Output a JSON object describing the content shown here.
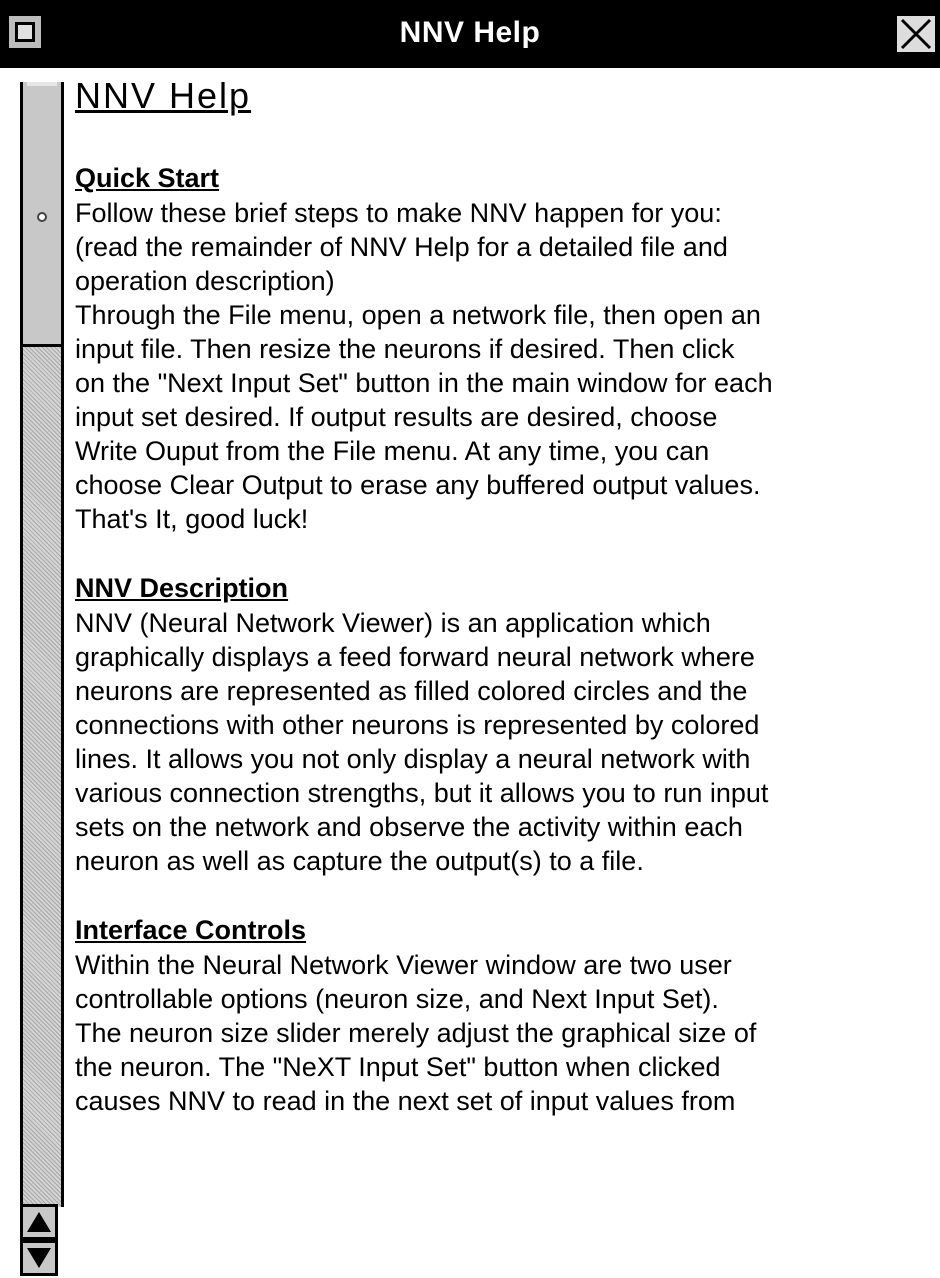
{
  "window": {
    "title": "NNV Help"
  },
  "help": {
    "heading": "NNV Help",
    "sections": [
      {
        "title": "Quick Start",
        "body": "Follow these brief steps to make NNV happen for you:\n(read the remainder of NNV Help for a detailed file and\noperation description)\nThrough the File menu, open a network file, then open an\ninput file.  Then resize the neurons if desired.  Then click\non the \"Next Input Set\" button in the main window for each\ninput set desired.  If output results are desired, choose\nWrite Ouput from the File menu.  At any time, you can\nchoose Clear Output to erase any buffered output values.\nThat's It, good luck!"
      },
      {
        "title": "NNV Description",
        "body": "NNV (Neural Network Viewer) is an application which\ngraphically displays a feed forward neural network where\nneurons are represented as filled colored circles and the\nconnections with other neurons is represented by colored\nlines.  It allows you not only display a neural network with\nvarious connection strengths, but it allows you to run input\nsets on the network and observe the activity within each\nneuron as well as capture the output(s) to a file."
      },
      {
        "title": "Interface Controls",
        "body": "Within the Neural Network Viewer window are two user\ncontrollable options (neuron size, and Next Input Set).\nThe neuron size slider merely adjust the graphical size of\nthe neuron.  The \"NeXT Input Set\" button when clicked\ncauses NNV to read in the next set of input values from"
      }
    ]
  }
}
